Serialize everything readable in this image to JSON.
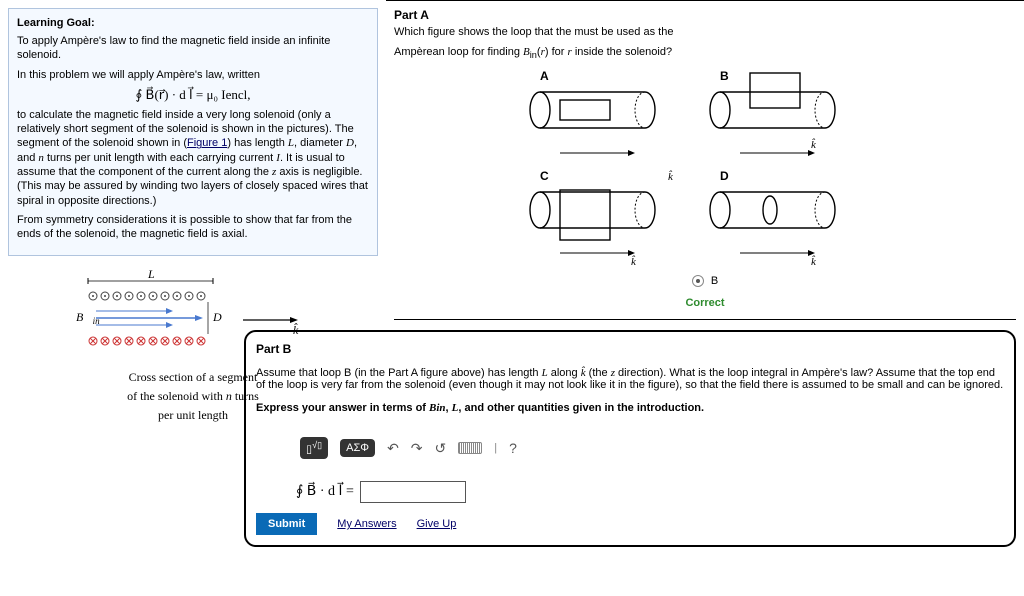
{
  "left": {
    "goal_hdr": "Learning Goal:",
    "goal_p1": "To apply Ampère's law to find the magnetic field inside an infinite solenoid.",
    "p2a": "In this problem we will apply Ampère's law, written",
    "eq1": "∮ B⃗(r⃗) · d l⃗ = μ₀ Iencl,",
    "p2b_a": "to calculate the magnetic field inside a very long solenoid (only a relatively short segment of the solenoid is shown in the pictures). The segment of the solenoid shown in (",
    "fig_link": "Figure 1",
    "p2b_b": ") has length ",
    "p2b_c": ", diameter ",
    "p2b_d": ", and ",
    "p2b_e": " turns per unit length with each carrying current ",
    "p2b_f": ". It is usual to assume that the component of the current along the ",
    "p2b_g": " axis is negligible. (This may be assured by winding two layers of closely spaced wires that spiral in opposite directions.)",
    "L": "L",
    "D": "D",
    "n": "n",
    "I": "I",
    "z": "z",
    "p3": "From symmetry considerations it is possible to show that far from the ends of the solenoid, the magnetic field is axial.",
    "fig_cap1": "Cross section of a segment",
    "fig_cap2": "of the solenoid with n turns",
    "fig_cap3": "per unit length"
  },
  "partA": {
    "hdr": "Part A",
    "q1": "Which figure shows the loop that the must be used as the",
    "q2": "Ampèrean loop for finding Bin(r) for r inside the solenoid?",
    "labels": {
      "A": "A",
      "B": "B",
      "C": "C",
      "D": "D"
    },
    "k": "k̂",
    "selected": "B",
    "correct": "Correct"
  },
  "partB": {
    "hdr": "Part B",
    "q_a": "Assume that loop B (in the Part A figure above) has length ",
    "q_l": "L",
    "q_b": " along ",
    "q_k": "k̂",
    "q_c": " (the ",
    "q_z": "z",
    "q_d": " direction). What is the loop integral in Ampère's law? Assume that the top end of the loop is very far from the solenoid (even though it may not look like it in the figure), so that the field there is assumed to be small and can be ignored.",
    "instr_a": "Express your answer in terms of ",
    "instr_b": "Bin",
    "instr_c": ", ",
    "instr_d": "L",
    "instr_e": ", and other quantities given in the introduction.",
    "toolbar_greek": "ΑΣΦ",
    "undo": "↶",
    "redo": "↷",
    "reset": "↺",
    "help": "?",
    "lhs": "∮ B⃗ · d l⃗ =",
    "submit": "Submit",
    "my_answers": "My Answers",
    "give_up": "Give Up"
  }
}
